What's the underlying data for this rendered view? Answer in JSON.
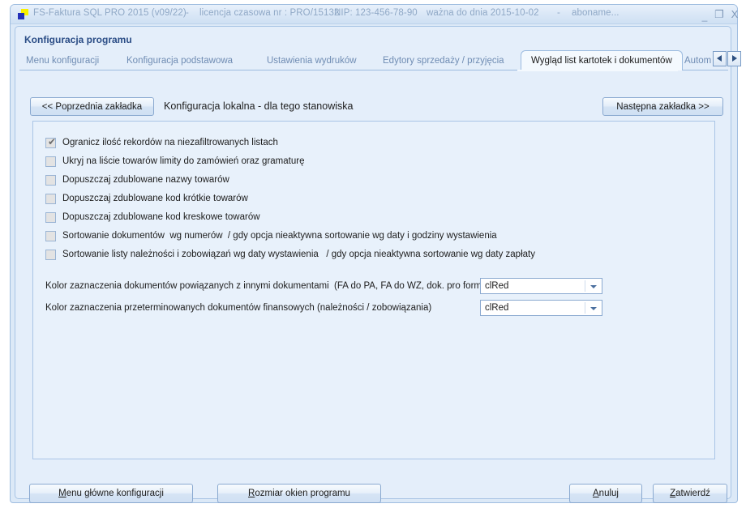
{
  "titlebar": {
    "app_name": "FS-Faktura SQL PRO 2015 (v09/22)",
    "sep1": "-",
    "license": "licencja czasowa nr : PRO/15132",
    "nip": "NIP: 123-456-78-90",
    "valid_until": "ważna do dnia 2015-10-02",
    "sep2": "-",
    "subscription": "aboname...",
    "minimize": "_",
    "maximize": "❐",
    "close": "X"
  },
  "dialog": {
    "caption": "Konfiguracja programu"
  },
  "tabs": {
    "items": [
      {
        "label": "Menu konfiguracji",
        "active": false
      },
      {
        "label": "Konfiguracja podstawowa",
        "active": false
      },
      {
        "label": "Ustawienia wydruków",
        "active": false
      },
      {
        "label": "Edytory sprzedaży / przyjęcia",
        "active": false
      },
      {
        "label": "Wygląd list kartotek i dokumentów",
        "active": true
      },
      {
        "label": "Autom",
        "active": false
      }
    ],
    "scroll_prev": "◀",
    "scroll_next": "▶"
  },
  "navrow": {
    "prev_tab": "<< Poprzednia zakładka",
    "next_tab": "Następna zakładka >>",
    "local_config": "Konfiguracja lokalna - dla tego stanowiska"
  },
  "options": [
    {
      "label": "Ogranicz ilość rekordów na niezafiltrowanych listach",
      "checked": true
    },
    {
      "label": "Ukryj na liście towarów limity do zamówień oraz gramaturę",
      "checked": false
    },
    {
      "label": "Dopuszczaj zdublowane nazwy towarów",
      "checked": false
    },
    {
      "label": "Dopuszczaj zdublowane kod krótkie towarów",
      "checked": false
    },
    {
      "label": "Dopuszczaj zdublowane kod kreskowe towarów",
      "checked": false
    },
    {
      "label": "Sortowanie dokumentów  wg numerów  / gdy opcja nieaktywna sortowanie wg daty i godziny wystawienia",
      "checked": false
    },
    {
      "label": "Sortowanie listy należności i zobowiązań wg daty wystawienia   / gdy opcja nieaktywna sortowanie wg daty zapłaty",
      "checked": false
    }
  ],
  "color_settings": [
    {
      "label": "Kolor zaznaczenia dokumentów powiązanych z innymi dokumentami  (FA do PA, FA do WZ, dok. pro forma itp)",
      "value": "clRed"
    },
    {
      "label": "Kolor zaznaczenia przeterminowanych dokumentów finansowych (należności / zobowiązania)",
      "value": "clRed"
    }
  ],
  "footer": {
    "main_menu_acc": "M",
    "main_menu_rest": "enu główne konfiguracji",
    "window_size_acc": "R",
    "window_size_rest": "ozmiar okien programu",
    "cancel_acc": "A",
    "cancel_rest": "nuluj",
    "confirm_acc": "Z",
    "confirm_rest": "atwierdź"
  },
  "theme": {
    "window_bg": "#dce9f7",
    "dialog_bg": "#e4eefa",
    "panel_bg": "#e8f1fb",
    "accent": "#2b4d86",
    "title_text": "#8fa8c6",
    "border": "#a8c4e4"
  }
}
